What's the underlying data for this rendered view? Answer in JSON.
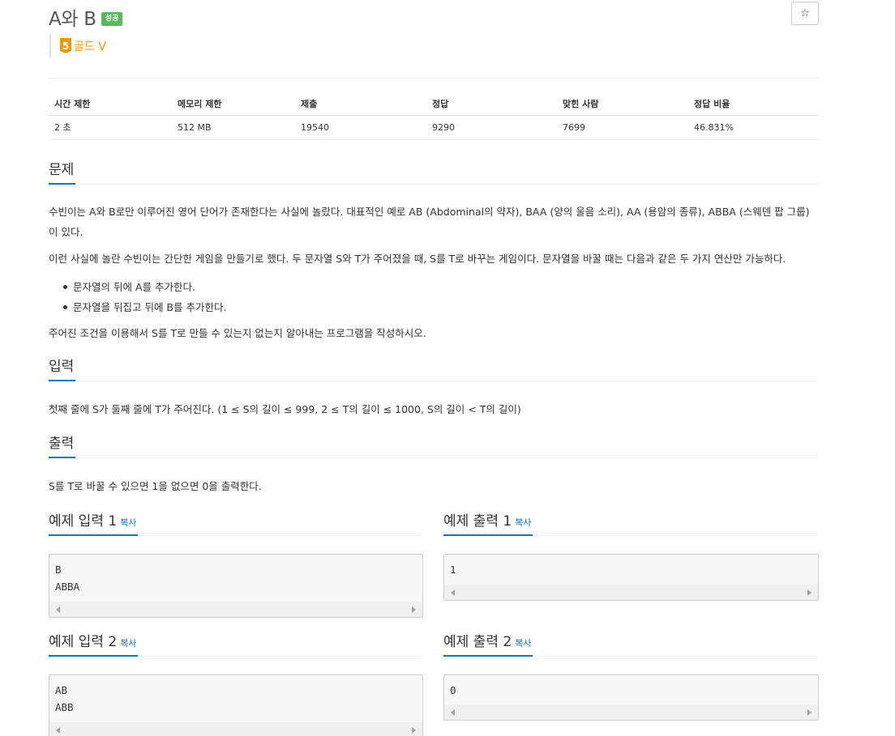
{
  "problem": {
    "title": "A와 B",
    "result_badge": "성공",
    "tier_level": "5",
    "tier_name": "골드 V",
    "star_icon": "☆"
  },
  "info_table": {
    "headers": [
      "시간 제한",
      "메모리 제한",
      "제출",
      "정답",
      "맞힌 사람",
      "정답 비율"
    ],
    "values": [
      "2 초",
      "512 MB",
      "19540",
      "9290",
      "7699",
      "46.831%"
    ]
  },
  "sections": {
    "description": {
      "heading": "문제",
      "p1": "수빈이는 A와 B로만 이루어진 영어 단어가 존재한다는 사실에 놀랐다. 대표적인 예로 AB (Abdominal의 약자), BAA (양의 울음 소리), AA (용암의 종류), ABBA (스웨덴 팝 그룹)이 있다.",
      "p2": "이런 사실에 놀란 수빈이는 간단한 게임을 만들기로 했다. 두 문자열 S와 T가 주어졌을 때, S를 T로 바꾸는 게임이다. 문자열을 바꿀 때는 다음과 같은 두 가지 연산만 가능하다.",
      "bullets": [
        "문자열의 뒤에 A를 추가한다.",
        "문자열을 뒤집고 뒤에 B를 추가한다."
      ],
      "p3": "주어진 조건을 이용해서 S를 T로 만들 수 있는지 없는지 알아내는 프로그램을 작성하시오."
    },
    "input": {
      "heading": "입력",
      "text": "첫째 줄에 S가 둘째 줄에 T가 주어진다. (1 ≤ S의 길이 ≤ 999, 2 ≤ T의 길이 ≤ 1000, S의 길이 < T의 길이)"
    },
    "output": {
      "heading": "출력",
      "text": "S를 T로 바꿀 수 있으면 1을 없으면 0을 출력한다."
    }
  },
  "samples": {
    "copy_label": "복사",
    "input1": {
      "heading": "예제 입력 1",
      "content": "B\nABBA"
    },
    "output1": {
      "heading": "예제 출력 1",
      "content": "1"
    },
    "input2": {
      "heading": "예제 입력 2",
      "content": "AB\nABB"
    },
    "output2": {
      "heading": "예제 출력 2",
      "content": "0"
    }
  }
}
